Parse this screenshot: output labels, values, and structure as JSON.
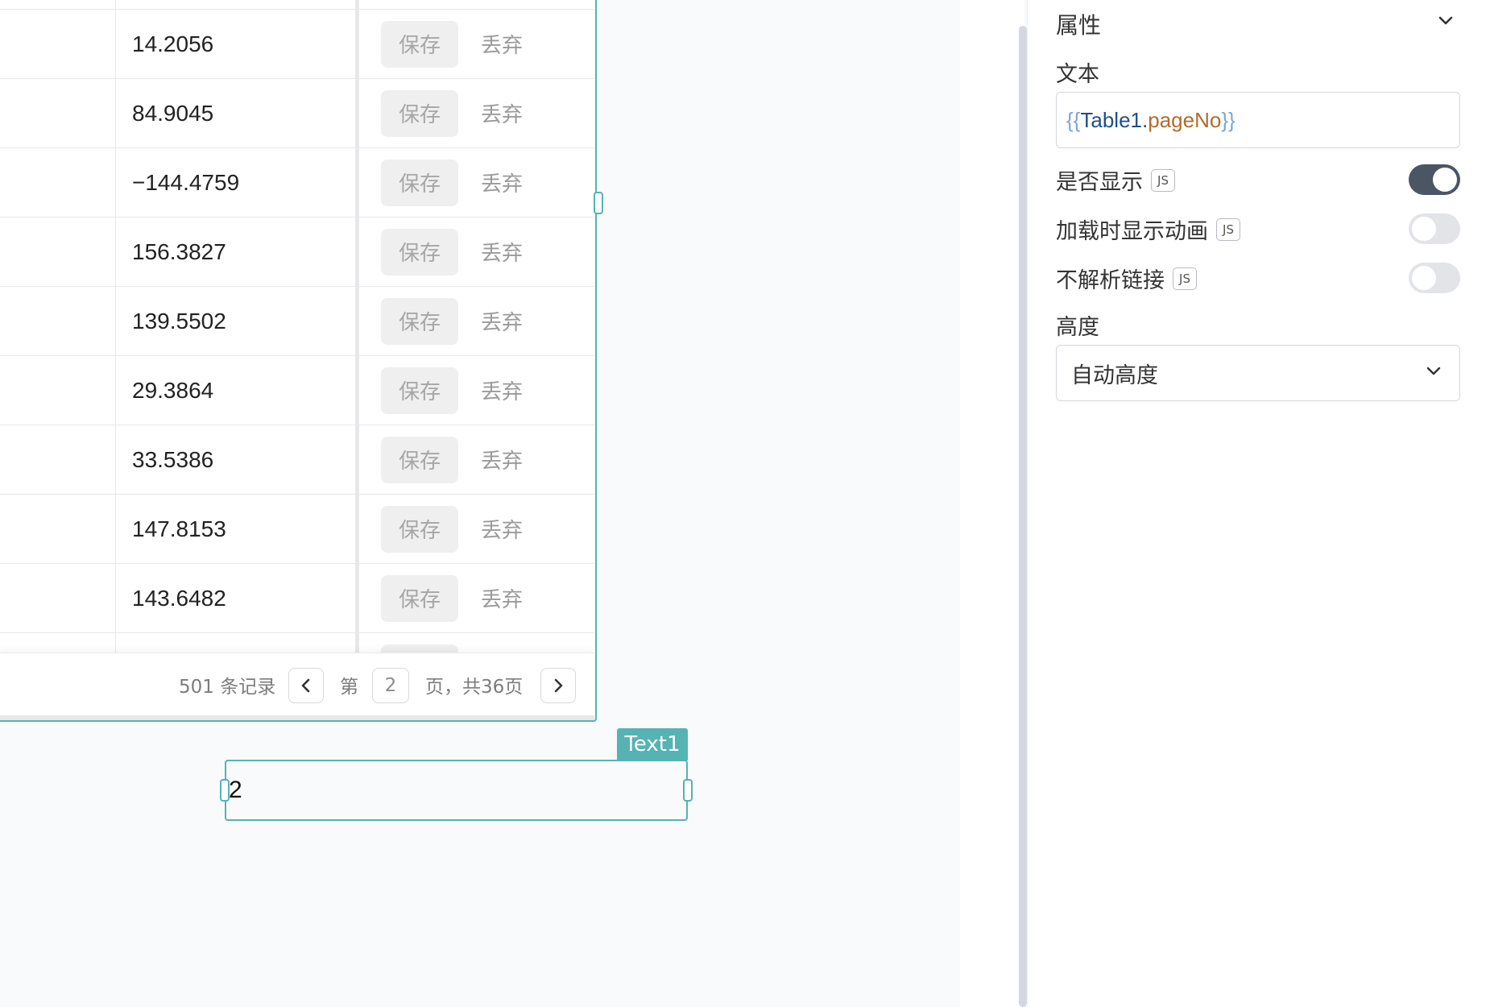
{
  "table": {
    "rows": [
      {
        "value": "14.2056",
        "save": "保存",
        "discard": "丢弃"
      },
      {
        "value": "84.9045",
        "save": "保存",
        "discard": "丢弃"
      },
      {
        "value": "−144.4759",
        "save": "保存",
        "discard": "丢弃"
      },
      {
        "value": "156.3827",
        "save": "保存",
        "discard": "丢弃"
      },
      {
        "value": "139.5502",
        "save": "保存",
        "discard": "丢弃"
      },
      {
        "value": "29.3864",
        "save": "保存",
        "discard": "丢弃"
      },
      {
        "value": "33.5386",
        "save": "保存",
        "discard": "丢弃"
      },
      {
        "value": "147.8153",
        "save": "保存",
        "discard": "丢弃"
      },
      {
        "value": "143.6482",
        "save": "保存",
        "discard": "丢弃"
      },
      {
        "value": "",
        "save": "",
        "discard": ""
      }
    ],
    "pagination": {
      "records": "501 条记录",
      "page_prefix": "第",
      "page_no": "2",
      "page_suffix": "页，共36页"
    }
  },
  "text_widget": {
    "label": "Text1",
    "value": "2"
  },
  "props": {
    "section_title": "属性",
    "text_label": "文本",
    "text_binding": {
      "open": "{{",
      "object": "Table1",
      "dot": ".",
      "property": "pageNo",
      "close": "}}"
    },
    "toggles": [
      {
        "label": "是否显示",
        "js": "JS",
        "on": true
      },
      {
        "label": "加载时显示动画",
        "js": "JS",
        "on": false
      },
      {
        "label": "不解析链接",
        "js": "JS",
        "on": false
      }
    ],
    "height_label": "高度",
    "height_value": "自动高度"
  },
  "colors": {
    "accent": "#55b3b3",
    "toggle_on": "#4b5563",
    "toggle_off": "#e2e4e8"
  }
}
